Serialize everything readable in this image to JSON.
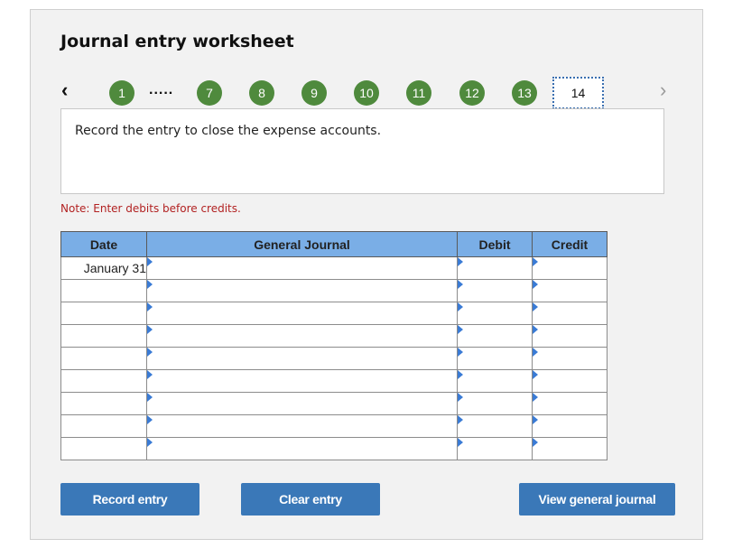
{
  "title": "Journal entry worksheet",
  "nav": {
    "prev_icon": "chevron-left-icon",
    "next_icon": "chevron-right-icon",
    "steps": [
      "1",
      "7",
      "8",
      "9",
      "10",
      "11",
      "12",
      "13"
    ],
    "ellipsis": ".....",
    "current_step": "14"
  },
  "prompt": "Record the entry to close the expense accounts.",
  "note": "Note: Enter debits before credits.",
  "table": {
    "headers": [
      "Date",
      "General Journal",
      "Debit",
      "Credit"
    ],
    "rows": [
      {
        "date": "January 31",
        "account": "",
        "debit": "",
        "credit": ""
      },
      {
        "date": "",
        "account": "",
        "debit": "",
        "credit": ""
      },
      {
        "date": "",
        "account": "",
        "debit": "",
        "credit": ""
      },
      {
        "date": "",
        "account": "",
        "debit": "",
        "credit": ""
      },
      {
        "date": "",
        "account": "",
        "debit": "",
        "credit": ""
      },
      {
        "date": "",
        "account": "",
        "debit": "",
        "credit": ""
      },
      {
        "date": "",
        "account": "",
        "debit": "",
        "credit": ""
      },
      {
        "date": "",
        "account": "",
        "debit": "",
        "credit": ""
      },
      {
        "date": "",
        "account": "",
        "debit": "",
        "credit": ""
      }
    ]
  },
  "buttons": {
    "record": "Record entry",
    "clear": "Clear entry",
    "view": "View general journal"
  },
  "colors": {
    "step_complete": "#4f8a3d",
    "header_bg": "#7aaee6",
    "button_bg": "#3a78b8",
    "note_text": "#b22222"
  }
}
